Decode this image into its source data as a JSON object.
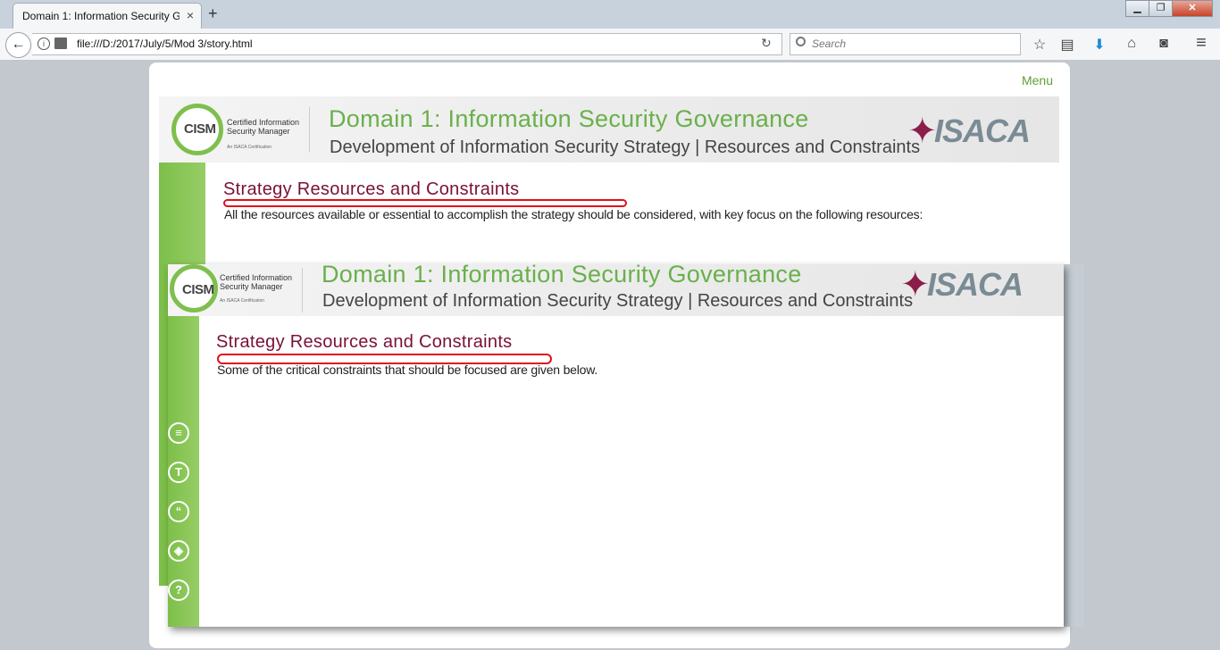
{
  "browser": {
    "tab_title": "Domain 1: Information Security G",
    "tab_close": "×",
    "new_tab": "+",
    "window_controls": {
      "minimize": "▁",
      "restore": "❐",
      "close": "✕"
    },
    "back": "←",
    "url": "file:///D:/2017/July/5/Mod 3/story.html",
    "reload": "↻",
    "search_placeholder": "Search",
    "toolbar_icons": {
      "bookmark": "☆",
      "reading_list": "▤",
      "download": "⬇",
      "home": "⌂",
      "pocket": "◙",
      "menu": "≡"
    }
  },
  "page": {
    "menu": "Menu",
    "slide1": {
      "logo": {
        "text": "CISM",
        "sub_line1": "Certified Information",
        "sub_line2": "Security Manager",
        "sub_tag": "An ISACA Certification"
      },
      "title": "Domain 1: Information Security Governance",
      "subtitle": "Development of Information Security Strategy | Resources and Constraints",
      "brand": "ISACA",
      "heading": "Strategy Resources and Constraints",
      "body": "All the resources available or essential to accomplish the strategy should be considered, with key focus on the following resources:"
    },
    "slide2": {
      "logo": {
        "text": "CISM",
        "sub_line1": "Certified Information",
        "sub_line2": "Security Manager",
        "sub_tag": "An ISACA Certification"
      },
      "title": "Domain 1: Information Security Governance",
      "subtitle": "Development of Information Security Strategy | Resources and Constraints",
      "brand": "ISACA",
      "heading": "Strategy Resources and Constraints",
      "body": "Some of the critical constraints that should be focused are given below."
    },
    "side_icons": [
      {
        "name": "notes-icon",
        "glyph": "≡"
      },
      {
        "name": "transcript-icon",
        "glyph": "T"
      },
      {
        "name": "quote-icon",
        "glyph": "“"
      },
      {
        "name": "resources-icon",
        "glyph": "◈"
      },
      {
        "name": "help-icon",
        "glyph": "?"
      }
    ],
    "colors": {
      "accent_green": "#7dbf4a",
      "heading": "#7a1038",
      "highlight": "#e0101c",
      "title_green": "#6ab04c"
    }
  }
}
